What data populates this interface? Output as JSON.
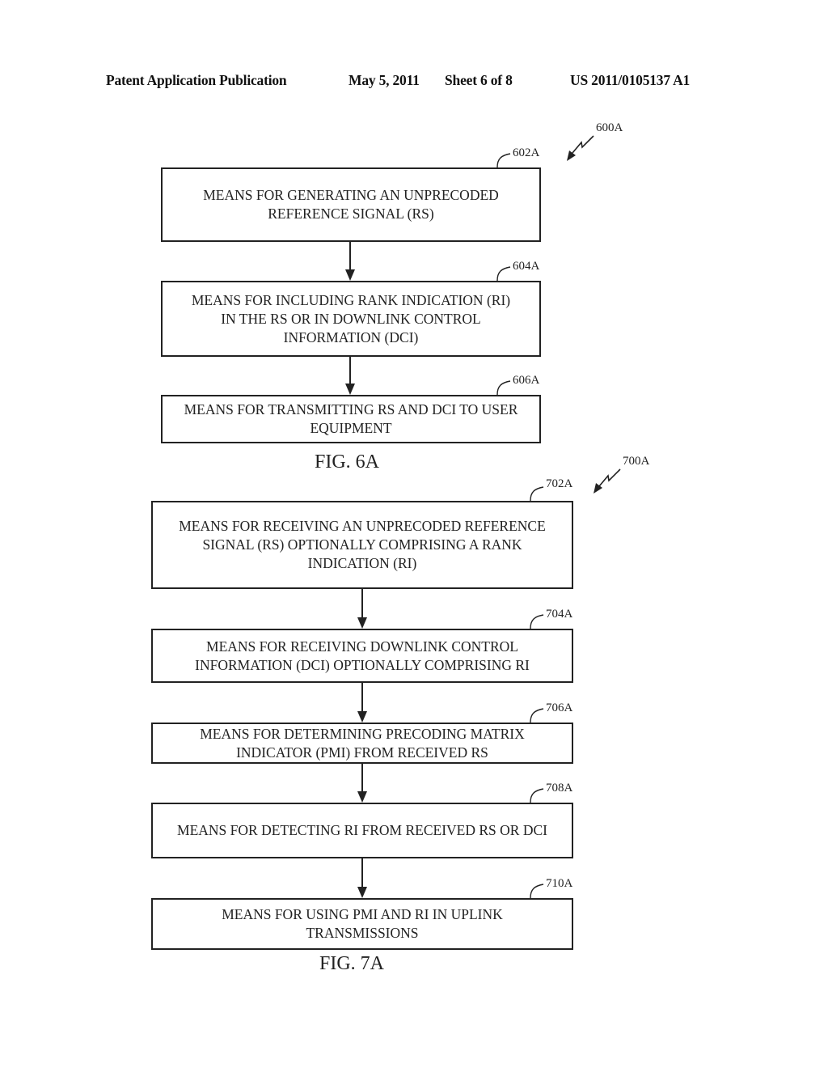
{
  "header": {
    "publication_type": "Patent Application Publication",
    "date": "May 5, 2011",
    "sheet": "Sheet 6 of 8",
    "publication_number": "US 2011/0105137 A1"
  },
  "figures": [
    {
      "id": "fig6a",
      "caption": "FIG. 6A",
      "ref": "600A",
      "steps": [
        {
          "ref": "602A",
          "text": "MEANS FOR GENERATING AN UNPRECODED REFERENCE SIGNAL (RS)",
          "lines": [
            "MEANS FOR GENERATING AN UNPRECODED",
            "REFERENCE SIGNAL (RS)"
          ]
        },
        {
          "ref": "604A",
          "text": "MEANS FOR INCLUDING RANK INDICATION (RI) IN THE RS OR IN DOWNLINK CONTROL INFORMATION (DCI)",
          "lines": [
            "MEANS FOR INCLUDING RANK INDICATION (RI)",
            "IN THE RS OR IN DOWNLINK CONTROL",
            "INFORMATION (DCI)"
          ]
        },
        {
          "ref": "606A",
          "text": "MEANS FOR TRANSMITTING RS AND DCI TO USER EQUIPMENT",
          "lines": [
            "MEANS FOR TRANSMITTING RS AND DCI TO USER",
            "EQUIPMENT"
          ]
        }
      ]
    },
    {
      "id": "fig7a",
      "caption": "FIG. 7A",
      "ref": "700A",
      "steps": [
        {
          "ref": "702A",
          "text": "MEANS FOR RECEIVING AN UNPRECODED REFERENCE SIGNAL (RS) OPTIONALLY COMPRISING A RANK INDICATION (RI)",
          "lines": [
            "MEANS FOR RECEIVING AN UNPRECODED REFERENCE",
            "SIGNAL (RS) OPTIONALLY COMPRISING A RANK",
            "INDICATION (RI)"
          ]
        },
        {
          "ref": "704A",
          "text": "MEANS FOR RECEIVING DOWNLINK CONTROL INFORMATION (DCI) OPTIONALLY COMPRISING RI",
          "lines": [
            "MEANS FOR RECEIVING DOWNLINK CONTROL",
            "INFORMATION (DCI) OPTIONALLY COMPRISING RI"
          ]
        },
        {
          "ref": "706A",
          "text": "MEANS FOR DETERMINING PRECODING MATRIX INDICATOR (PMI) FROM RECEIVED RS",
          "lines": [
            "MEANS FOR DETERMINING PRECODING MATRIX",
            "INDICATOR (PMI) FROM RECEIVED RS"
          ]
        },
        {
          "ref": "708A",
          "text": "MEANS FOR DETECTING RI FROM RECEIVED RS OR DCI",
          "lines": [
            "MEANS FOR DETECTING RI FROM RECEIVED RS OR DCI"
          ]
        },
        {
          "ref": "710A",
          "text": "MEANS FOR USING PMI AND RI IN UPLINK TRANSMISSIONS",
          "lines": [
            "MEANS FOR USING PMI AND RI IN UPLINK",
            "TRANSMISSIONS"
          ]
        }
      ]
    }
  ]
}
